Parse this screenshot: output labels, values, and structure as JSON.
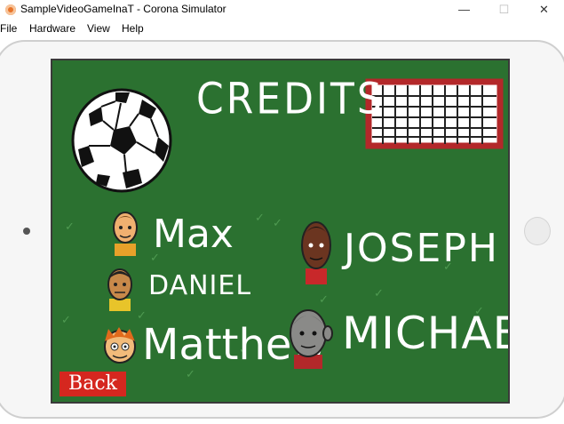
{
  "window": {
    "title": "SampleVideoGameInaT - Corona Simulator",
    "controls": {
      "minimize": "—",
      "maximize": "☐",
      "close": "✕"
    }
  },
  "menubar": {
    "items": [
      "File",
      "Hardware",
      "View",
      "Help"
    ]
  },
  "game": {
    "heading": "CREDITS",
    "names": {
      "max": "Max",
      "daniel": "DANIEL",
      "matthew": "Matthew",
      "joseph": "JOSEPH",
      "michael": "MICHAEL"
    },
    "back_label": "Back",
    "colors": {
      "field": "#2b7130",
      "goal_frame": "#b3282a",
      "back_button": "#d5271f",
      "text": "#ffffff"
    }
  }
}
